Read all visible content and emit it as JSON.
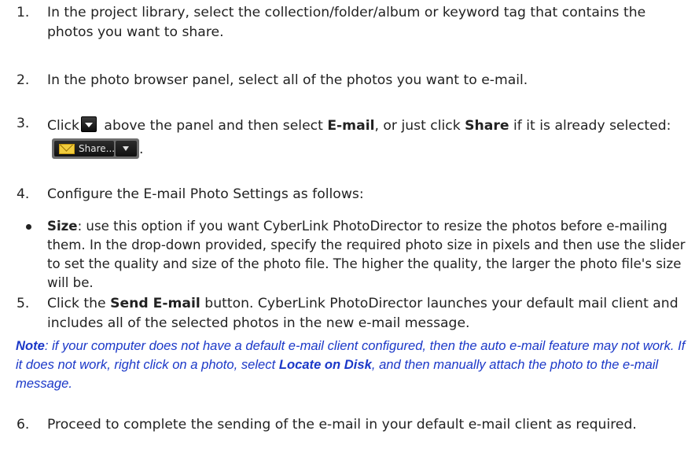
{
  "steps": [
    {
      "num": "1.",
      "text": "In the project library, select the collection/folder/album or keyword tag that contains the photos you want to share."
    },
    {
      "num": "2.",
      "text": "In the photo browser panel, select all of the photos you want to e-mail."
    },
    {
      "num": "3.",
      "click": "Click",
      "after_icon": " above the panel and then select ",
      "email_bold": "E-mail",
      "or_click": ", or just click ",
      "share_bold": "Share",
      "if_selected": " if it is already selected: ",
      "end": "."
    },
    {
      "num": "4.",
      "text": "Configure the E-mail Photo Settings as follows:"
    },
    {
      "num": "5.",
      "click": "Click the ",
      "button_bold": "Send E-mail",
      "rest": " button. CyberLink PhotoDirector launches your default mail client and includes all of the selected photos in the new e-mail message."
    },
    {
      "num": "6.",
      "text": "Proceed to complete the sending of the e-mail in your default e-mail client as required."
    }
  ],
  "bullet": {
    "label": "Size",
    "text": ": use this option if you want CyberLink PhotoDirector to resize the photos before e-mailing them. In the drop-down provided, specify the required photo size in pixels and then use the slider to set the quality and size of the photo file. The higher the quality, the larger the photo file's size will be."
  },
  "note": {
    "label": "Note",
    "text1": ": if your computer does not have a default e-mail client configured, then the auto e-mail feature may not work. If it does not work, right click on a photo, select ",
    "locate_bold": "Locate on Disk",
    "text2": ", and then manually attach the photo to the e-mail message."
  },
  "share_widget": {
    "label": "Share..."
  },
  "icons": {
    "dropdown": "dropdown-arrow-icon",
    "envelope": "envelope-icon"
  },
  "colors": {
    "note_text": "#1b38c8",
    "body_text": "#222222"
  }
}
